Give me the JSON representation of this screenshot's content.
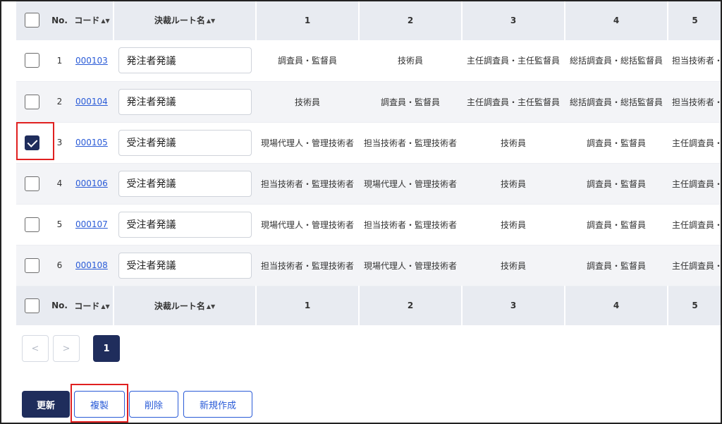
{
  "header": {
    "no_label": "No.",
    "code_label": "コード",
    "name_label": "決裁ルート名",
    "sort_icon": "sort-icon",
    "step_labels": [
      "1",
      "2",
      "3",
      "4",
      "5"
    ]
  },
  "rows": [
    {
      "no": "1",
      "code": "000103",
      "name": "発注者発議",
      "checked": false,
      "steps": [
        "調査員・監督員",
        "技術員",
        "主任調査員・主任監督員",
        "総括調査員・総括監督員",
        "担当技術者・"
      ]
    },
    {
      "no": "2",
      "code": "000104",
      "name": "発注者発議",
      "checked": false,
      "steps": [
        "技術員",
        "調査員・監督員",
        "主任調査員・主任監督員",
        "総括調査員・総括監督員",
        "担当技術者・"
      ]
    },
    {
      "no": "3",
      "code": "000105",
      "name": "受注者発議",
      "checked": true,
      "steps": [
        "現場代理人・管理技術者",
        "担当技術者・監理技術者",
        "技術員",
        "調査員・監督員",
        "主任調査員・"
      ]
    },
    {
      "no": "4",
      "code": "000106",
      "name": "受注者発議",
      "checked": false,
      "steps": [
        "担当技術者・監理技術者",
        "現場代理人・管理技術者",
        "技術員",
        "調査員・監督員",
        "主任調査員・"
      ]
    },
    {
      "no": "5",
      "code": "000107",
      "name": "受注者発議",
      "checked": false,
      "steps": [
        "現場代理人・管理技術者",
        "担当技術者・監理技術者",
        "技術員",
        "調査員・監督員",
        "主任調査員・"
      ]
    },
    {
      "no": "6",
      "code": "000108",
      "name": "受注者発議",
      "checked": false,
      "steps": [
        "担当技術者・監理技術者",
        "現場代理人・管理技術者",
        "技術員",
        "調査員・監督員",
        "主任調査員・"
      ]
    }
  ],
  "pagination": {
    "prev": "<",
    "next": ">",
    "current": "1"
  },
  "actions": {
    "update": "更新",
    "copy": "複製",
    "delete": "削除",
    "create": "新規作成"
  },
  "colors": {
    "primary": "#1f2d5c",
    "link": "#2a5bd7",
    "highlight": "#e02020",
    "header_bg": "#e8ebf1"
  }
}
